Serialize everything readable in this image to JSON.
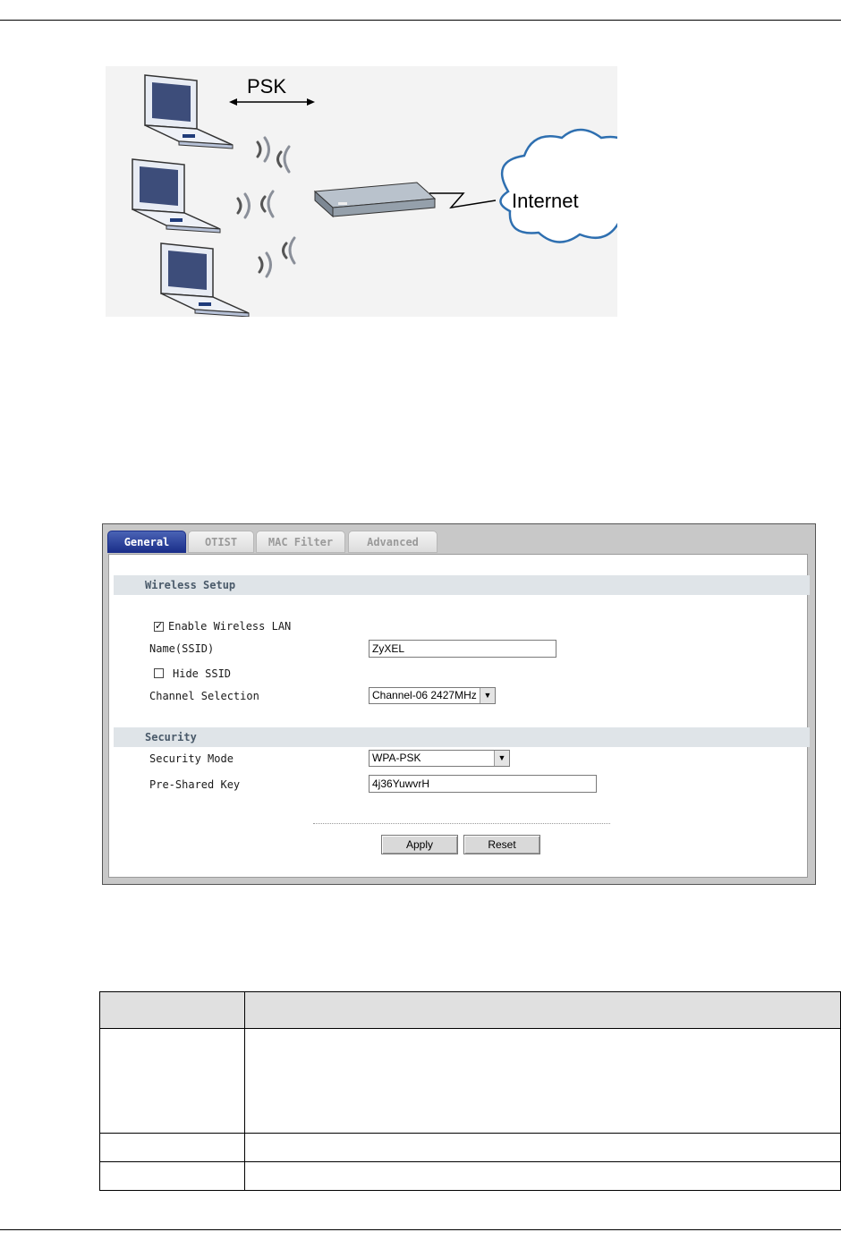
{
  "diagram": {
    "psk_label": "PSK",
    "cloud_label": "Internet",
    "icons": [
      "laptop-icon",
      "wireless-signal-icon",
      "router-icon",
      "cloud-icon"
    ]
  },
  "screenshot": {
    "tabs": [
      {
        "label": "General",
        "active": true
      },
      {
        "label": "OTIST",
        "active": false
      },
      {
        "label": "MAC Filter",
        "active": false
      },
      {
        "label": "Advanced",
        "active": false
      }
    ],
    "wireless_setup": {
      "title": "Wireless Setup",
      "enable_wireless_lan": {
        "label": "Enable Wireless LAN",
        "checked": true
      },
      "ssid": {
        "label": "Name(SSID)",
        "value": "ZyXEL"
      },
      "hide_ssid": {
        "label": "Hide SSID",
        "checked": false
      },
      "channel": {
        "label": "Channel Selection",
        "value": "Channel-06 2427MHz"
      }
    },
    "security": {
      "title": "Security",
      "mode": {
        "label": "Security Mode",
        "value": "WPA-PSK"
      },
      "psk": {
        "label": "Pre-Shared Key",
        "value": "4j36YuwvrH"
      }
    },
    "buttons": {
      "apply": "Apply",
      "reset": "Reset"
    }
  },
  "colors": {
    "active_tab": "#1b2f8a",
    "section_bar": "#dfe4e8",
    "panel_bg": "#c8c8c8"
  }
}
